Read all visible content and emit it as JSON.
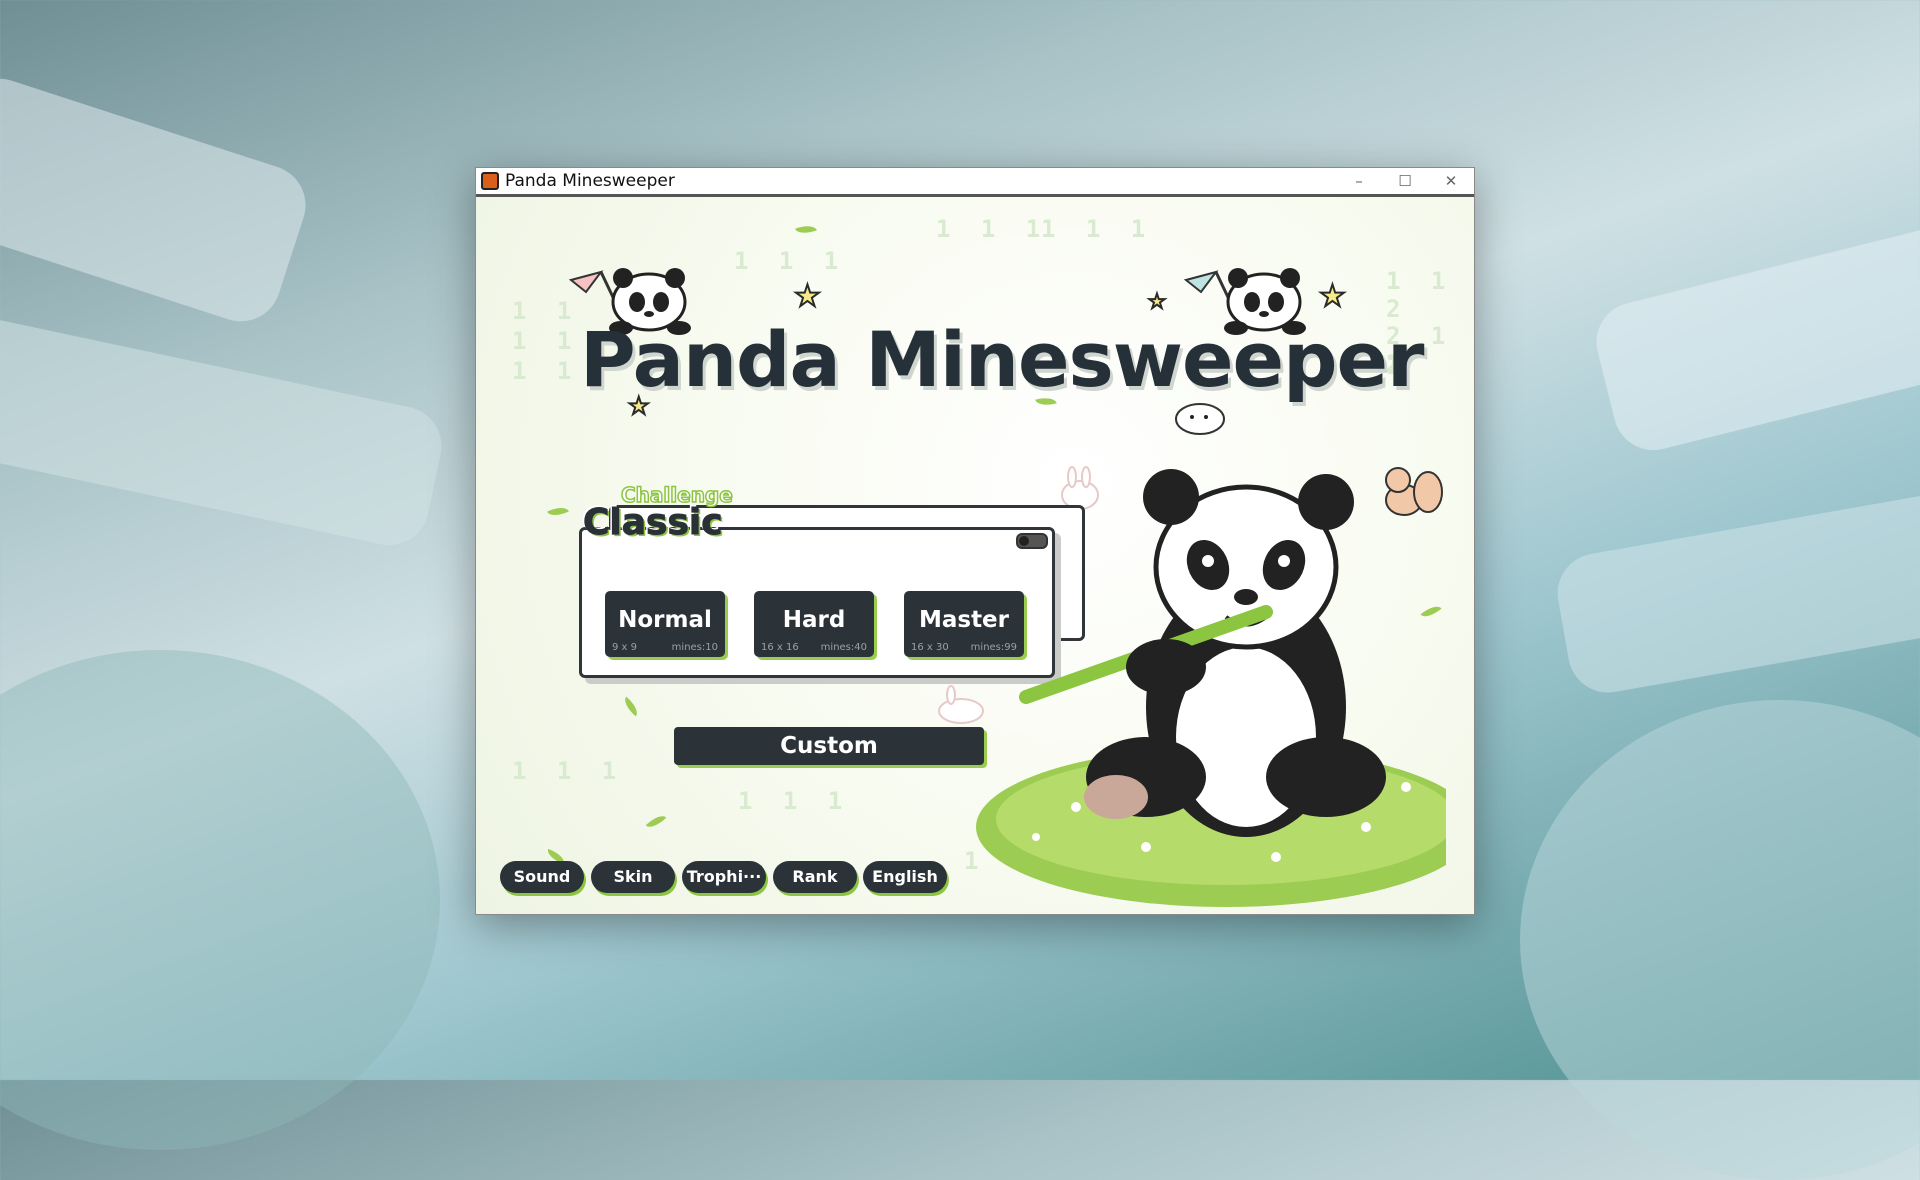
{
  "window": {
    "title": "Panda Minesweeper",
    "min_glyph": "–",
    "max_glyph": "☐",
    "close_glyph": "✕"
  },
  "game": {
    "title": "Panda Minesweeper",
    "panel": {
      "tab_label": "Challenge",
      "title": "Classic"
    },
    "modes": [
      {
        "label": "Normal",
        "size": "9 x 9",
        "mines": "mines:10"
      },
      {
        "label": "Hard",
        "size": "16 x 16",
        "mines": "mines:40"
      },
      {
        "label": "Master",
        "size": "16 x 30",
        "mines": "mines:99"
      }
    ],
    "custom_label": "Custom",
    "bottom": {
      "sound": "Sound",
      "skin": "Skin",
      "trophies": "Trophi···",
      "rank": "Rank",
      "language": "English"
    },
    "bg_digits": [
      "1 1 1",
      "1 1 1",
      "1 1 1",
      "1 1",
      "1 1",
      "1 1",
      "1 1 2",
      "2 1 2",
      "1",
      "1 1 1",
      "1 1 1",
      "1"
    ]
  },
  "colors": {
    "accent": "#9acd4f",
    "button": "#2b3339",
    "title_text": "#263038"
  }
}
